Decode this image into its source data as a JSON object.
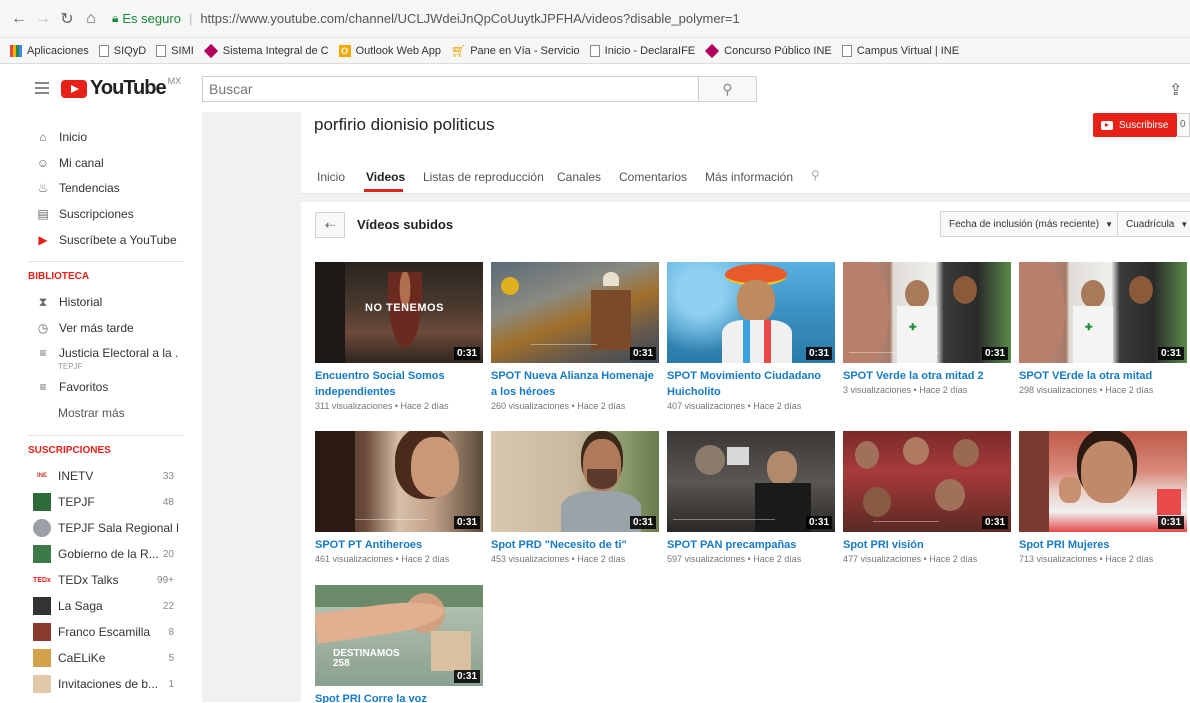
{
  "browser": {
    "secure_label": "Es seguro",
    "url": "https://www.youtube.com/channel/UCLJWdeiJnQpCoUuytkJPFHA/videos?disable_polymer=1",
    "bookmarks": [
      {
        "label": "Aplicaciones",
        "icon": "apps-grid-icon"
      },
      {
        "label": "SIQyD",
        "icon": "page-icon"
      },
      {
        "label": "SIMI",
        "icon": "page-icon"
      },
      {
        "label": "Sistema Integral de C",
        "icon": "ine-icon"
      },
      {
        "label": "Outlook Web App",
        "icon": "outlook-icon"
      },
      {
        "label": "Pane en Vía - Servicio",
        "icon": "pane-icon"
      },
      {
        "label": "Inicio - DeclaraIFE",
        "icon": "page-icon"
      },
      {
        "label": "Concurso Público INE",
        "icon": "ine-icon"
      },
      {
        "label": "Campus Virtual | INE",
        "icon": "page-icon"
      }
    ]
  },
  "header": {
    "logo_text": "YouTube",
    "region": "MX",
    "search_placeholder": "Buscar"
  },
  "sidebar": {
    "main": [
      {
        "label": "Inicio",
        "icon": "home-icon"
      },
      {
        "label": "Mi canal",
        "icon": "account-icon"
      },
      {
        "label": "Tendencias",
        "icon": "flame-icon"
      },
      {
        "label": "Suscripciones",
        "icon": "subscriptions-icon"
      },
      {
        "label": "Suscríbete a YouTube ...",
        "icon": "youtube-icon"
      }
    ],
    "library_title": "BIBLIOTECA",
    "library": [
      {
        "label": "Historial",
        "icon": "hourglass-icon"
      },
      {
        "label": "Ver más tarde",
        "icon": "clock-icon"
      },
      {
        "label": "Justicia Electoral a la ...",
        "icon": "playlist-icon",
        "sub": "TEPJF"
      },
      {
        "label": "Favoritos",
        "icon": "playlist-icon"
      }
    ],
    "show_more": "Mostrar más",
    "subs_title": "SUSCRIPCIONES",
    "subscriptions": [
      {
        "label": "INETV",
        "count": "33",
        "color": "#c0392b",
        "badge": "INE"
      },
      {
        "label": "TEPJF",
        "count": "48",
        "color": "#2e6b3a",
        "badge": ""
      },
      {
        "label": "TEPJF Sala Regional E...",
        "count": "",
        "color": "#9aa0a6",
        "badge": ""
      },
      {
        "label": "Gobierno de la R...",
        "count": "20",
        "color": "#3d7a4a",
        "badge": ""
      },
      {
        "label": "TEDx Talks",
        "count": "99+",
        "color": "#ffffff",
        "badge": "TEDx"
      },
      {
        "label": "La Saga",
        "count": "22",
        "color": "#333333",
        "badge": ""
      },
      {
        "label": "Franco Escamilla",
        "count": "8",
        "color": "#8a3b2b",
        "badge": ""
      },
      {
        "label": "CaELiKe",
        "count": "5",
        "color": "#d4a24a",
        "badge": ""
      },
      {
        "label": "Invitaciones de b...",
        "count": "1",
        "color": "#e0c8a8",
        "badge": ""
      }
    ]
  },
  "channel": {
    "name": "porfirio dionisio politicus",
    "subscribe_label": "Suscribirse",
    "subscriber_count": "0",
    "tabs": [
      "Inicio",
      "Videos",
      "Listas de reproducción",
      "Canales",
      "Comentarios",
      "Más información"
    ],
    "active_tab": "Videos"
  },
  "videos_section": {
    "title": "Vídeos subidos",
    "sort_label": "Fecha de inclusión (más reciente)",
    "view_label": "Cuadrícula"
  },
  "videos": [
    {
      "title": "Encuentro Social Somos independientes",
      "meta": "311 visualizaciones • Hace 2 días",
      "duration": "0:31",
      "overlay": "NO TENEMOS"
    },
    {
      "title": "SPOT Nueva Alianza Homenaje a los héroes",
      "meta": "260 visualizaciones • Hace 2 días",
      "duration": "0:31",
      "overlay": ""
    },
    {
      "title": "SPOT Movimiento Ciudadano Huicholito",
      "meta": "407 visualizaciones • Hace 2 días",
      "duration": "0:31",
      "overlay": ""
    },
    {
      "title": "SPOT Verde la otra mitad 2",
      "meta": "3 visualizaciones • Hace 2 días",
      "duration": "0:31",
      "overlay": ""
    },
    {
      "title": "SPOT VErde la otra mitad",
      "meta": "298 visualizaciones • Hace 2 días",
      "duration": "0:31",
      "overlay": ""
    },
    {
      "title": "SPOT PT Antiheroes",
      "meta": "461 visualizaciones • Hace 2 días",
      "duration": "0:31",
      "overlay": ""
    },
    {
      "title": "Spot PRD \"Necesito de ti\"",
      "meta": "453 visualizaciones • Hace 2 días",
      "duration": "0:31",
      "overlay": ""
    },
    {
      "title": "SPOT PAN precampañas",
      "meta": "597 visualizaciones • Hace 2 días",
      "duration": "0:31",
      "overlay": ""
    },
    {
      "title": "Spot PRI visión",
      "meta": "477 visualizaciones • Hace 2 días",
      "duration": "0:31",
      "overlay": ""
    },
    {
      "title": "Spot PRI Mujeres",
      "meta": "713 visualizaciones • Hace 2 días",
      "duration": "0:31",
      "overlay": ""
    },
    {
      "title": "Spot PRI Corre la voz",
      "meta": "",
      "duration": "0:31",
      "overlay": "DESTINAMOS 258"
    }
  ],
  "colors": {
    "youtube_red": "#e62117",
    "link_blue": "#167ac6",
    "secure_green": "#1a8a3a"
  }
}
